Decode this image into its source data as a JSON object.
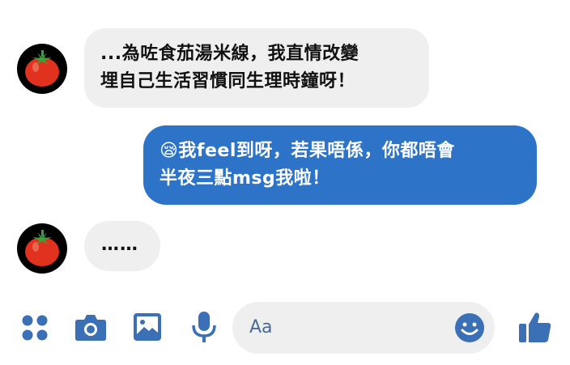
{
  "conversation": {
    "messages": [
      {
        "sender": "contact",
        "lines": [
          "...為咗食茄湯米線，我直情改變",
          "埋自己生活習慣同生理時鐘呀！"
        ]
      },
      {
        "sender": "me",
        "lines": [
          "😪我feel到呀，若果唔係，你都唔會",
          "半夜三點msg我啦！"
        ]
      },
      {
        "sender": "contact",
        "text": "……"
      }
    ]
  },
  "composer": {
    "placeholder": "Aa",
    "icons": [
      "apps-icon",
      "camera-icon",
      "image-icon",
      "microphone-icon",
      "emoji-icon",
      "thumbs-up-icon"
    ]
  },
  "colors": {
    "accent": "#2d73c8",
    "incoming_bubble": "#efefef",
    "icon": "#3b6fb6"
  }
}
